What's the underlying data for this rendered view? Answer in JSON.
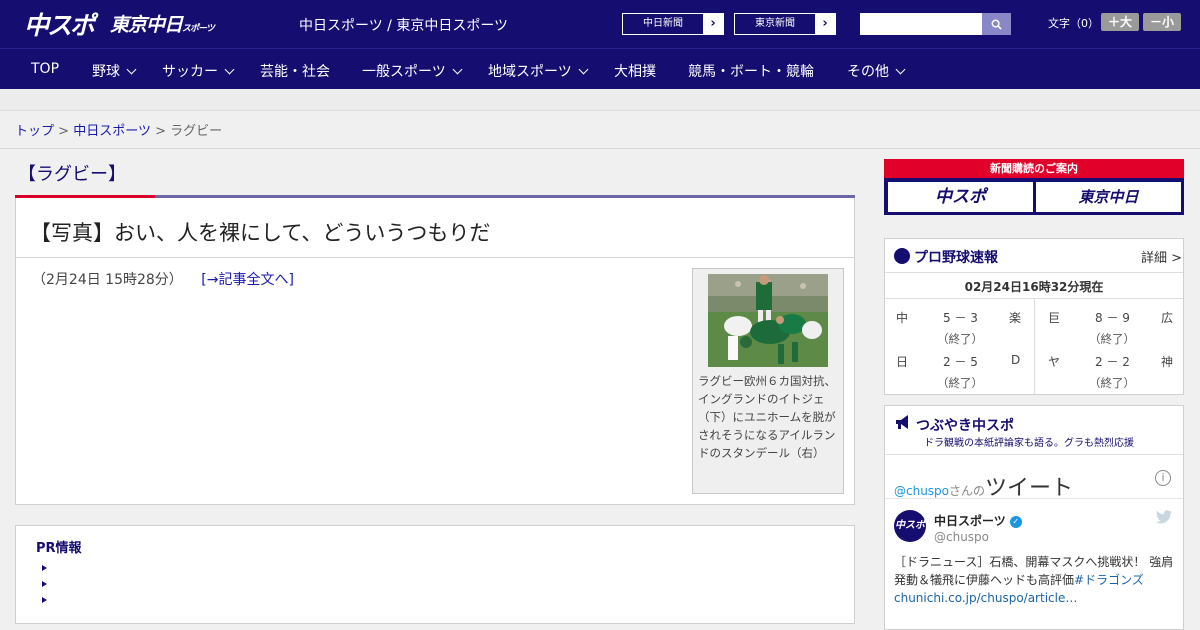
{
  "header": {
    "logo_chuspo": "中スポ",
    "logo_tokyo": "東京中日",
    "logo_tokyo_sub": "スポーツ",
    "site_title": "中日スポーツ / 東京中日スポーツ",
    "ext_links": [
      "中日新聞",
      "東京新聞"
    ],
    "search_placeholder": "",
    "font_size_label": "文字（0）",
    "font_plus": "＋大",
    "font_minus": "－小"
  },
  "nav": [
    {
      "label": "TOP",
      "dropdown": false
    },
    {
      "label": "野球",
      "dropdown": true
    },
    {
      "label": "サッカー",
      "dropdown": true
    },
    {
      "label": "芸能・社会",
      "dropdown": false
    },
    {
      "label": "一般スポーツ",
      "dropdown": true
    },
    {
      "label": "地域スポーツ",
      "dropdown": true
    },
    {
      "label": "大相撲",
      "dropdown": false
    },
    {
      "label": "競馬・ボート・競輪",
      "dropdown": false
    },
    {
      "label": "その他",
      "dropdown": true
    }
  ],
  "breadcrumb": {
    "top": "トップ",
    "section": "中日スポーツ",
    "current": "ラグビー",
    "sep": ">"
  },
  "article": {
    "category": "【ラグビー】",
    "title": "【写真】おい、人を裸にして、どういうつもりだ",
    "date": "（2月24日 15時28分）",
    "full_link": "[→記事全文へ]",
    "caption": "ラグビー欧州６カ国対抗、イングランドのイトジェ（下）にユニホームを脱がされそうになるアイルランドのスタンデール（右）"
  },
  "pr": {
    "title": "PR情報",
    "items": [
      "",
      "",
      ""
    ]
  },
  "subscribe": {
    "head": "新聞購読のご案内",
    "logo1": "中スポ",
    "logo2": "東京中日"
  },
  "baseball": {
    "title": "プロ野球速報",
    "detail": "詳細 >",
    "time": "02月24日16時32分現在",
    "games": [
      {
        "home": "中",
        "score": "5 － 3",
        "away": "楽",
        "status": "（終了）"
      },
      {
        "home": "巨",
        "score": "8 － 9",
        "away": "広",
        "status": "（終了）"
      },
      {
        "home": "日",
        "score": "2 － 5",
        "away": "D",
        "status": "（終了）"
      },
      {
        "home": "ヤ",
        "score": "2 － 2",
        "away": "神",
        "status": "（終了）"
      }
    ]
  },
  "twitter": {
    "title": "つぶやき中スポ",
    "subtitle": "ドラ観戦の本紙評論家も語る。グラも熱烈応援",
    "user_handle": "@chuspo",
    "san_no": "さんの",
    "tweet_word": "ツイート",
    "info": "i",
    "account_name": "中日スポーツ",
    "account_handle": "@chuspo",
    "avatar": "中スポ",
    "tweet_text": "［ドラニュース］石橋、開幕マスクへ挑戦状！ 強肩発動＆犠飛に伊藤ヘッドも高評価",
    "tweet_hashtag": "#ドラゴンズ",
    "tweet_link": "chunichi.co.jp/chuspo/article…"
  }
}
